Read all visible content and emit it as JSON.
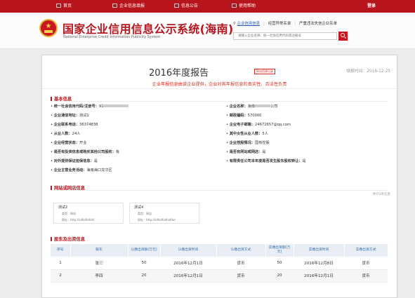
{
  "nav": {
    "items": [
      {
        "label": "首页",
        "icon": "home-icon"
      },
      {
        "label": "企业信息填报",
        "icon": "edit-icon"
      },
      {
        "label": "信息公告",
        "icon": "notice-icon"
      },
      {
        "label": "使用帮助",
        "icon": "help-icon"
      }
    ],
    "login_label": "登录"
  },
  "header": {
    "site_title": "国家企业信用信息公示系统(海南)",
    "site_subtitle": "National Enterprise Credit Information Publicity System",
    "links": [
      "企业信用信息",
      "经营异常名录",
      "严重违法失信企业名单"
    ],
    "search_placeholder": "请输入企业名称、统一社会信用代码或注册号"
  },
  "colors": {
    "brand_red": "#b8141b",
    "notice_red": "#d9281e",
    "table_header_text": "#2f6cab"
  },
  "report": {
    "title": "2016年度报告",
    "badge": "网站搭建记录",
    "fill_date": "填报时间：2016-12-25",
    "notice": "企业年报信息由该企业提供，企业对其年报信息的真实性、合法性负责"
  },
  "basic": {
    "title": "基本信息",
    "fields": [
      {
        "label": "统一社会信用代码/注册号：",
        "value": "91"
      },
      {
        "label": "企业名称：",
        "value": "海南",
        "value_tail": "公司"
      },
      {
        "label": "企业通信地址：",
        "value": "测试1"
      },
      {
        "label": "邮政编码：",
        "value": "570000"
      },
      {
        "label": "企业联系电话：",
        "value": "36374838"
      },
      {
        "label": "企业电子邮箱：",
        "value": "24672657@qq.com"
      },
      {
        "label": "从业人数：",
        "value": "24人"
      },
      {
        "label": "其中女性从业人数：",
        "value": "5人"
      },
      {
        "label": "企业经营状态：",
        "value": "开业"
      },
      {
        "label": "企业控股情况：",
        "value": "国有控股"
      },
      {
        "label": "是否有投资信息或购买其他公司股权：",
        "value": "有"
      },
      {
        "label": "是否有网站或网店：",
        "value": "是"
      },
      {
        "label": "对外提供保证担保信息：",
        "value": "是"
      },
      {
        "label": "有限责任公司本年度是否发生股东股权转让：",
        "value": "是"
      },
      {
        "label": "企业主营业务活动：",
        "value": "海南海口龙华区"
      }
    ]
  },
  "websites": {
    "title": "网站或网店信息",
    "count_text": "共计2条信息",
    "type_label": "类型：",
    "url_label": "网址：",
    "items": [
      {
        "name": "测试2",
        "type": "网站",
        "url": "http://sdfsdfafdsf"
      },
      {
        "name": "测试4",
        "type": "网店",
        "url": "http://sdfsdfadfsdfad"
      }
    ]
  },
  "shareholders": {
    "title": "股东及出资信息",
    "headers": [
      "序号",
      "股东",
      "认缴出资额(万元)",
      "认缴出资时间",
      "认缴出资方式",
      "实缴出资额(万元)",
      "实缴出资时间",
      "实缴出资方式"
    ],
    "rows": [
      [
        "1",
        "张三",
        "50",
        "2016年12月1日",
        "货币",
        "50",
        "2016年12月8日",
        "货币"
      ],
      [
        "2",
        "李四",
        "20",
        "2016年12月1日",
        "货币",
        "20",
        "2016年12月1日",
        "货币"
      ]
    ]
  }
}
